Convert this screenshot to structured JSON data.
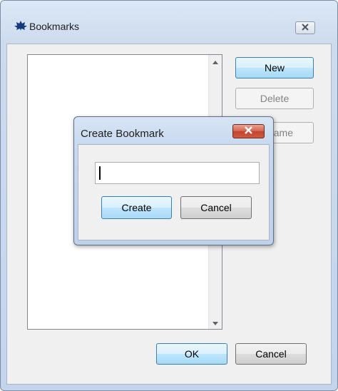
{
  "window": {
    "title": "Bookmarks",
    "icon": "maple-leaf-icon",
    "close_icon": "close-icon"
  },
  "bookmark_list": {
    "items": [],
    "scroll_up_icon": "chevron-up-icon",
    "scroll_down_icon": "chevron-down-icon"
  },
  "side_buttons": {
    "new": "New",
    "delete": "Delete",
    "rename_visible": "ame"
  },
  "footer": {
    "ok": "OK",
    "cancel": "Cancel"
  },
  "dialog": {
    "title": "Create Bookmark",
    "input_value": "",
    "create": "Create",
    "cancel": "Cancel",
    "close_accent": "#c0432d"
  },
  "colors": {
    "default_button_border": "#3c7fb1",
    "frame": "#c3d4eb"
  }
}
